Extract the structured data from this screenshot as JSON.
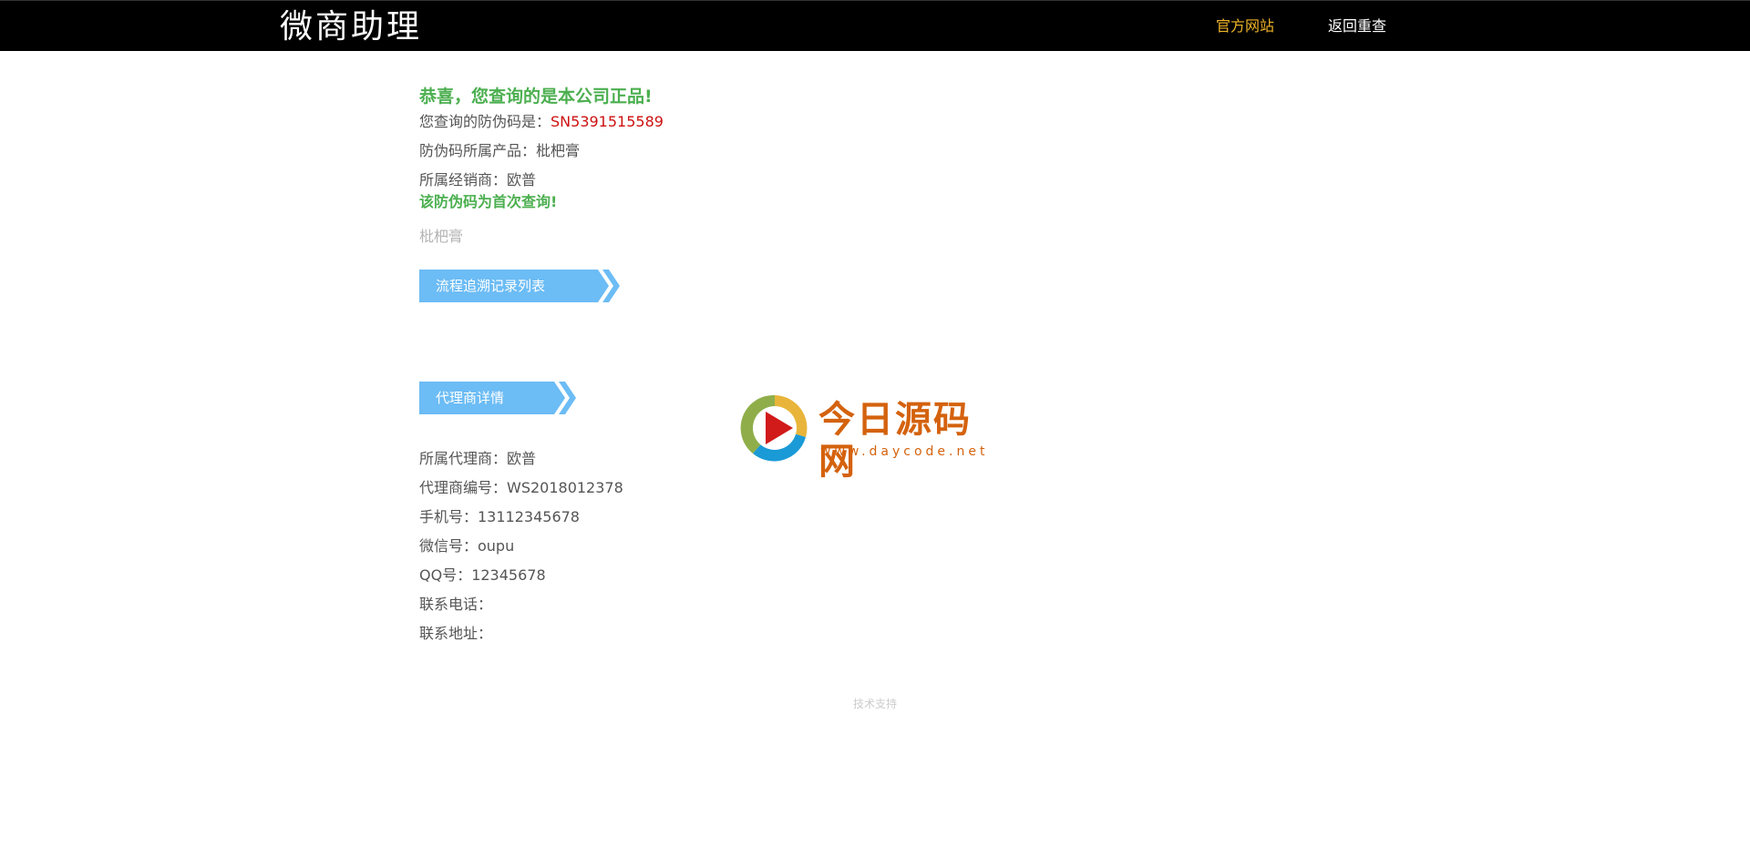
{
  "header": {
    "brand": "微商助理",
    "nav": {
      "official_site": "官方网站",
      "back_requery": "返回重查"
    }
  },
  "result": {
    "headline": "恭喜，您查询的是本公司正品!",
    "code_label": "您查询的防伪码是：",
    "code_value": "SN5391515589",
    "product_line": "防伪码所属产品：枇杷膏",
    "dealer_line": "所属经销商：欧普",
    "first_query_notice": "该防伪码为首次查询!",
    "product_name": "枇杷膏"
  },
  "trace_section": {
    "title": "流程追溯记录列表"
  },
  "agent_section": {
    "title": "代理商详情",
    "fields": [
      "所属代理商：欧普",
      "代理商编号：WS2018012378",
      "手机号：13112345678",
      "微信号：oupu",
      "QQ号：12345678",
      "联系电话：",
      "联系地址："
    ]
  },
  "watermark": {
    "title": "今日源码网",
    "url": "www.daycode.net"
  },
  "footer": {
    "text": "技术支持"
  },
  "colors": {
    "header_bg": "#000000",
    "nav_active": "#f0b429",
    "nav_default": "#ffffff",
    "success_green": "#4caf50",
    "code_red": "#cc1111",
    "ribbon_blue": "#6cbcf5",
    "watermark_orange": "#d4620e",
    "footer_gray": "#cccccc"
  }
}
